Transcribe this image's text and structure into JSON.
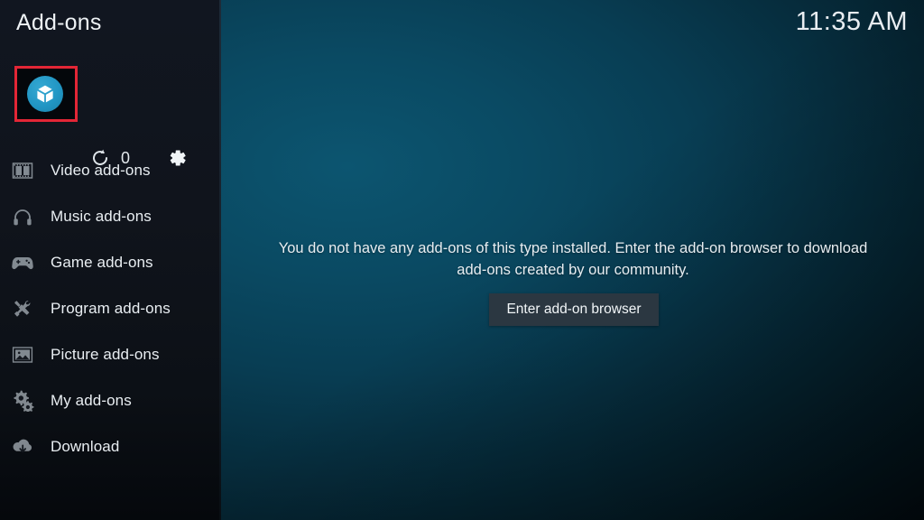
{
  "header": {
    "title": "Add-ons",
    "clock": "11:35 AM"
  },
  "toolbar": {
    "addon_button_icon": "package-icon",
    "refresh_icon": "refresh-icon",
    "refresh_count": "0",
    "settings_icon": "gear-icon",
    "highlight_color": "#e32636",
    "addon_button_color": "#2196c4"
  },
  "sidebar": {
    "items": [
      {
        "label": "Video add-ons",
        "icon": "film-strip-icon"
      },
      {
        "label": "Music add-ons",
        "icon": "headphones-icon"
      },
      {
        "label": "Game add-ons",
        "icon": "gamepad-icon"
      },
      {
        "label": "Program add-ons",
        "icon": "tools-icon"
      },
      {
        "label": "Picture add-ons",
        "icon": "picture-icon"
      },
      {
        "label": "My add-ons",
        "icon": "gears-icon"
      },
      {
        "label": "Download",
        "icon": "cloud-download-icon"
      }
    ]
  },
  "main": {
    "empty_message": "You do not have any add-ons of this type installed. Enter the add-on browser to download add-ons created by our community.",
    "browser_button_label": "Enter add-on browser"
  }
}
